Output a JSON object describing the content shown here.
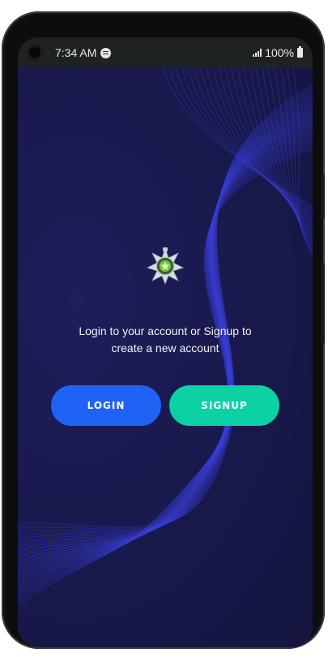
{
  "statusbar": {
    "time": "7:34 AM",
    "battery": "100%",
    "icons": [
      "camera-icon",
      "spotify-icon",
      "signal-icon",
      "battery-icon"
    ]
  },
  "welcome": {
    "message_line1": "Login to your account or Signup to",
    "message_line2": "create a new account",
    "login_label": "LOGIN",
    "signup_label": "SIGNUP"
  },
  "colors": {
    "background": "#1a1a4e",
    "wave_lines": "#3a3fd8",
    "login_button": "#1e63f5",
    "signup_button": "#0cd1a5",
    "statusbar": "#1f2222"
  }
}
